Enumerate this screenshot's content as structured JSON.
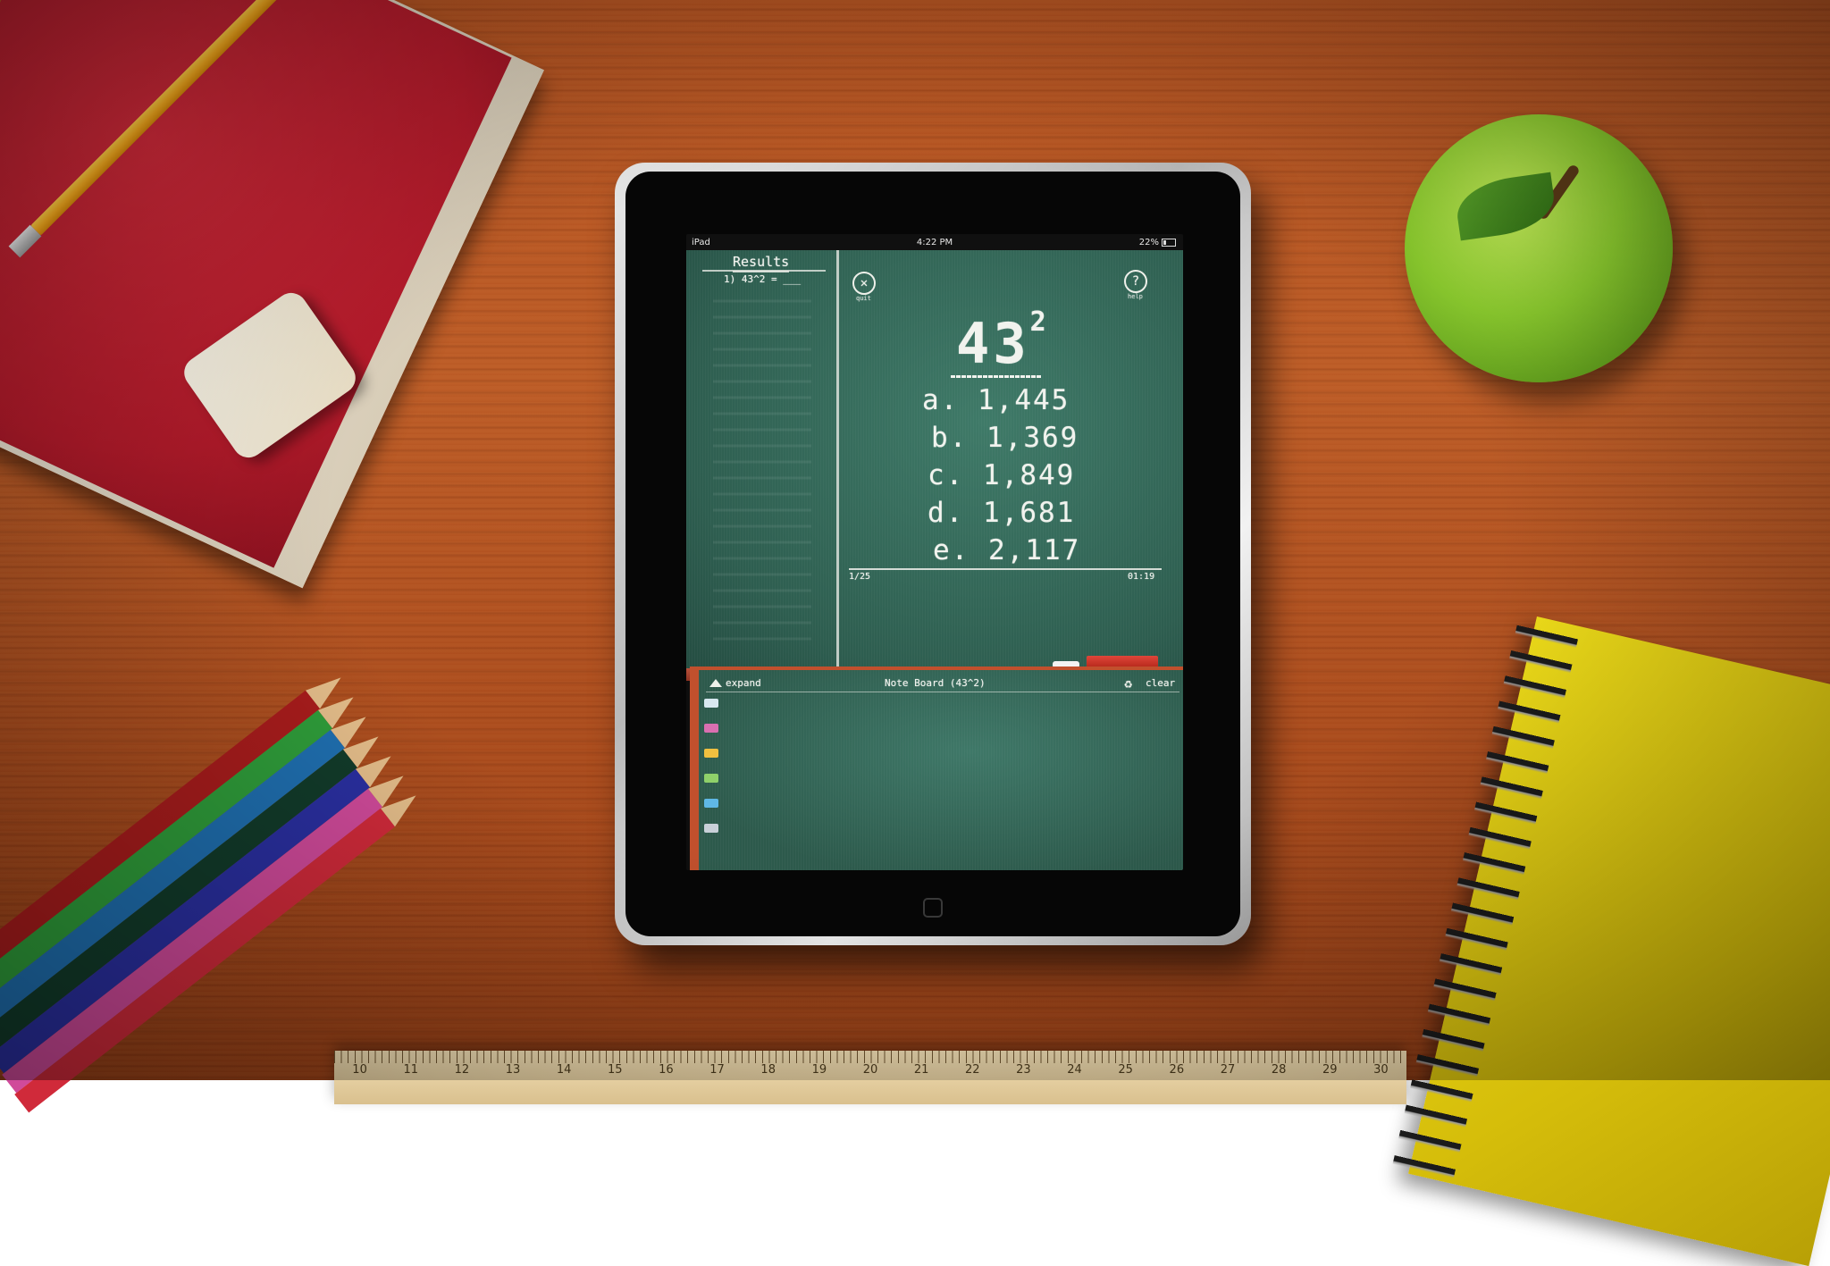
{
  "status_bar": {
    "device": "iPad",
    "time": "4:22 PM",
    "battery": "22%"
  },
  "results": {
    "title": "Results",
    "first_item": "1) 43^2 = ___"
  },
  "controls": {
    "quit_caption": "quit",
    "help_caption": "help"
  },
  "question": {
    "base": "43",
    "exponent": "2"
  },
  "choices": [
    {
      "letter": "a.",
      "value": "1,445"
    },
    {
      "letter": "b.",
      "value": "1,369"
    },
    {
      "letter": "c.",
      "value": "1,849"
    },
    {
      "letter": "d.",
      "value": "1,681"
    },
    {
      "letter": "e.",
      "value": "2,117"
    }
  ],
  "progress": {
    "counter": "1/25",
    "timer": "01:19"
  },
  "note_board": {
    "expand_label": "expand",
    "title": "Note Board (43^2)",
    "clear_label": "clear",
    "chalk_colors": [
      "#d8e8f0",
      "#d96fb0",
      "#f0c040",
      "#8fd06a",
      "#5fb8e6",
      "#c8d0d8"
    ]
  },
  "scene": {
    "ruler_numbers": [
      "10",
      "11",
      "12",
      "13",
      "14",
      "15",
      "16",
      "17",
      "18",
      "19",
      "20",
      "21",
      "22",
      "23",
      "24",
      "25",
      "26",
      "27",
      "28",
      "29",
      "30"
    ],
    "colored_pencils": [
      "#a81c1c",
      "#2f9d3a",
      "#1f6fb0",
      "#123b2a",
      "#2a2fa0",
      "#d04a9a",
      "#d02a3a"
    ]
  }
}
